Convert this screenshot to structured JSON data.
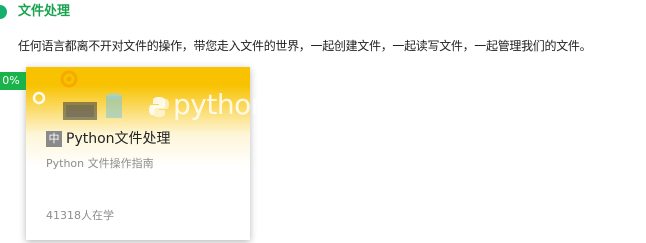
{
  "section": {
    "title": "文件处理",
    "description": "任何语言都离不开对文件的操作，带您走入文件的世界，一起创建文件，一起读写文件，一起管理我们的文件。"
  },
  "course_card": {
    "progress": "0%",
    "level_badge": "中",
    "title": "Python文件处理",
    "subtitle": "Python 文件操作指南",
    "learners": "41318人在学",
    "banner_wordmark": "python",
    "colors": {
      "banner": "#f8c200",
      "progress_badge": "#19b24b",
      "section_title": "#19a34f",
      "level_badge": "#8a8a8a"
    }
  }
}
